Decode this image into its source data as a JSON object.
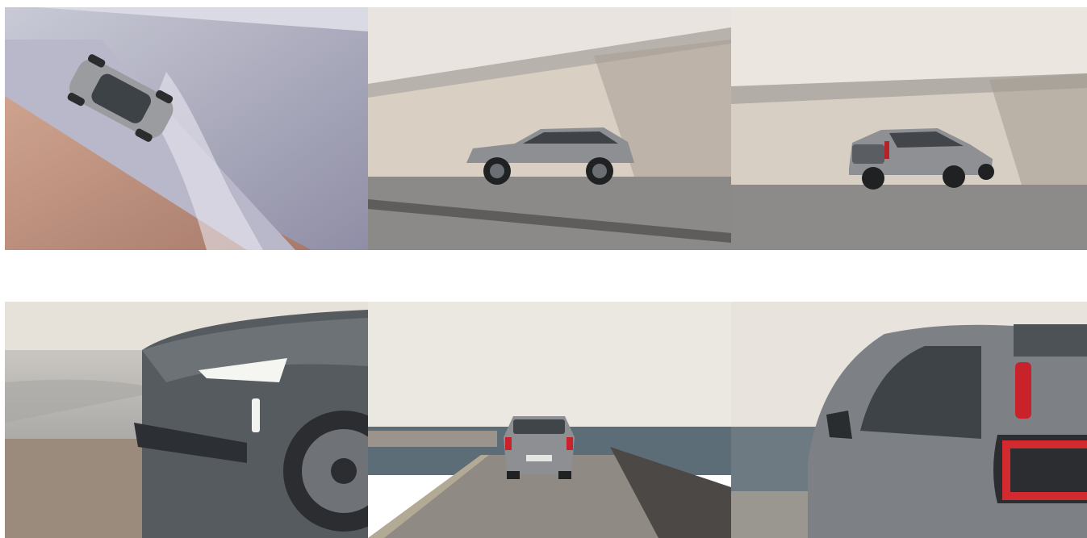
{
  "gallery": {
    "items": [
      {
        "subject": "car-top-view",
        "icon": "car-aerial-image"
      },
      {
        "subject": "car-side-view",
        "icon": "car-side-image"
      },
      {
        "subject": "car-rear-three-quarter",
        "icon": "car-rear-quarter-image"
      },
      {
        "subject": "car-front-headlight",
        "icon": "car-headlight-image"
      },
      {
        "subject": "car-rear-on-pier",
        "icon": "car-pier-image"
      },
      {
        "subject": "car-taillight-closeup",
        "icon": "car-taillight-image"
      }
    ],
    "colors": {
      "car_body": "#8a8d8f",
      "sky": "#ece7e1",
      "concrete": "#d8d0c6",
      "sea": "#5f6f7a",
      "taillight": "#c8232a"
    }
  }
}
